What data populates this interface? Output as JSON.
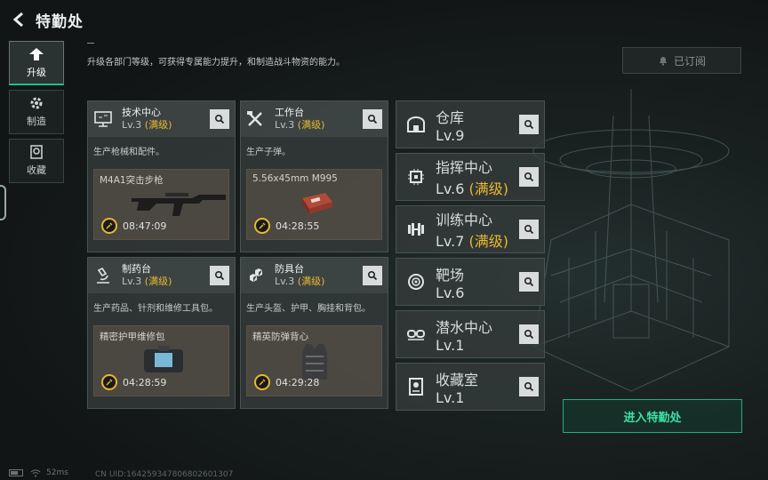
{
  "header": {
    "title": "特勤处",
    "back_icon": "back-chevron-icon"
  },
  "nav": [
    {
      "label": "升级",
      "icon": "upgrade-icon",
      "active": true
    },
    {
      "label": "制造",
      "icon": "gear-icon",
      "active": false
    },
    {
      "label": "收藏",
      "icon": "collection-icon",
      "active": false
    }
  ],
  "description": "升级各部门等级，可获得专属能力提升，和制造战斗物资的能力。",
  "subscribe": {
    "label": "已订阅"
  },
  "cards": [
    {
      "name": "技术中心",
      "level": "Lv.3",
      "status": "(满级)",
      "desc": "生产枪械和配件。",
      "product": "M4A1突击步枪",
      "timer": "08:47:09"
    },
    {
      "name": "工作台",
      "level": "Lv.3",
      "status": "(满级)",
      "desc": "生产子弹。",
      "product": "5.56x45mm M995",
      "timer": "04:28:55"
    },
    {
      "name": "制药台",
      "level": "Lv.3",
      "status": "(满级)",
      "desc": "生产药品、针剂和维修工具包。",
      "product": "精密护甲维修包",
      "timer": "04:28:59"
    },
    {
      "name": "防具台",
      "level": "Lv.3",
      "status": "(满级)",
      "desc": "生产头盔、护甲、胸挂和背包。",
      "product": "精英防弹背心",
      "timer": "04:29:28"
    }
  ],
  "side_cards": [
    {
      "name": "仓库",
      "level": "Lv.9",
      "status": ""
    },
    {
      "name": "指挥中心",
      "level": "Lv.6",
      "status": "(满级)"
    },
    {
      "name": "训练中心",
      "level": "Lv.7",
      "status": "(满级)"
    },
    {
      "name": "靶场",
      "level": "Lv.6",
      "status": ""
    },
    {
      "name": "潜水中心",
      "level": "Lv.1",
      "status": ""
    },
    {
      "name": "收藏室",
      "level": "Lv.1",
      "status": ""
    }
  ],
  "enter_button": {
    "label": "进入特勤处"
  },
  "footer": {
    "ping": "52ms",
    "uid": "CN UID:164259347806802601307"
  },
  "colors": {
    "accent": "#1fbf8f",
    "maxlevel": "#e8b830"
  }
}
